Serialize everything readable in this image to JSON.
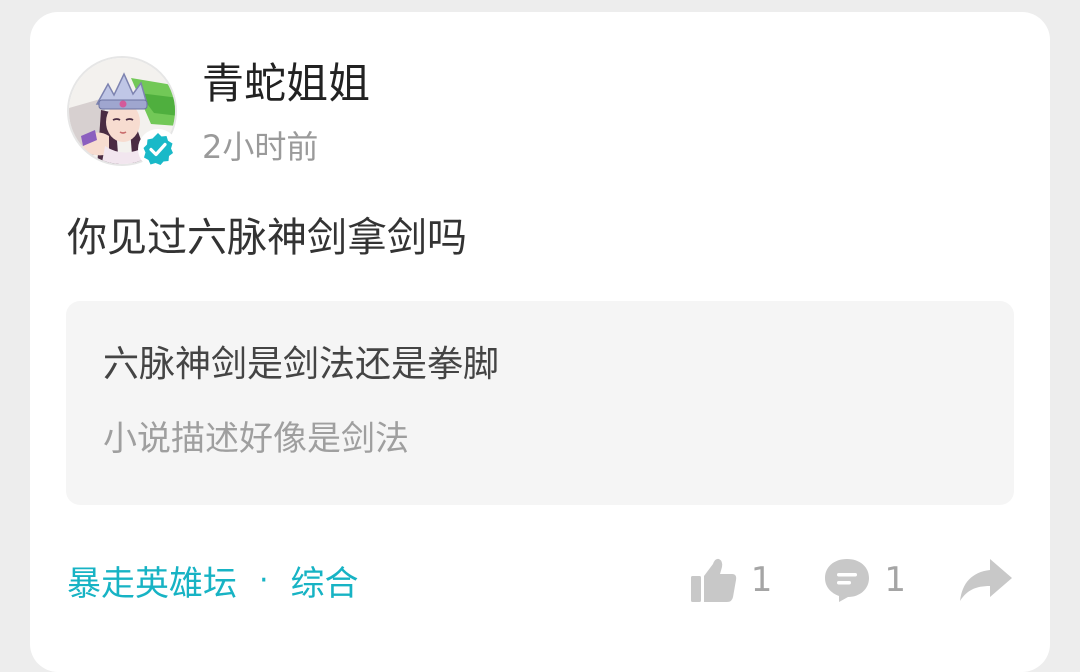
{
  "post": {
    "author": {
      "name": "青蛇姐姐",
      "avatar_icon": "anime-character-avatar",
      "verified_icon": "verified-check-badge-icon"
    },
    "timestamp": "2小时前",
    "text": "你见过六脉神剑拿剑吗",
    "quote": {
      "title": "六脉神剑是剑法还是拳脚",
      "subtitle": "小说描述好像是剑法"
    },
    "tags": {
      "forum": "暴走英雄坛",
      "separator": "·",
      "category": "综合"
    },
    "actions": {
      "like_count": "1",
      "comment_count": "1",
      "like_icon": "thumbs-up-icon",
      "comment_icon": "comment-bubble-icon",
      "share_icon": "share-arrow-icon"
    }
  },
  "colors": {
    "accent": "#17b3c4",
    "verified": "#19b9c8",
    "background": "#ededed",
    "card": "#ffffff",
    "quote_background": "#f5f5f5"
  }
}
